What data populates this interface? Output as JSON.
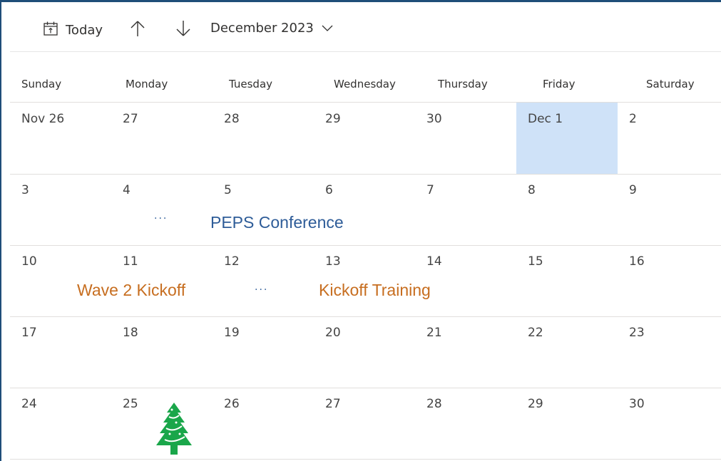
{
  "toolbar": {
    "today_label": "Today",
    "month_label": "December 2023",
    "icons": [
      "calendar-today-icon",
      "arrow-up-icon",
      "arrow-down-icon",
      "chevron-down-icon"
    ]
  },
  "weekdays": [
    "Sunday",
    "Monday",
    "Tuesday",
    "Wednesday",
    "Thursday",
    "Friday",
    "Saturday"
  ],
  "weeks": [
    [
      "Nov 26",
      "27",
      "28",
      "29",
      "30",
      "Dec 1",
      "2"
    ],
    [
      "3",
      "4",
      "5",
      "6",
      "7",
      "8",
      "9"
    ],
    [
      "10",
      "11",
      "12",
      "13",
      "14",
      "15",
      "16"
    ],
    [
      "17",
      "18",
      "19",
      "20",
      "21",
      "22",
      "23"
    ],
    [
      "24",
      "25",
      "26",
      "27",
      "28",
      "29",
      "30"
    ]
  ],
  "highlighted_day": "Dec 1",
  "events": {
    "peps": "PEPS Conference",
    "wave2": "Wave 2 Kickoff",
    "kickoff_training": "Kickoff Training",
    "more_indicator": "···"
  },
  "colors": {
    "accent_blue": "#2e5c98",
    "event_orange": "#c76e20",
    "today_highlight": "#cfe2f8",
    "tree_green": "#1aa64a"
  }
}
